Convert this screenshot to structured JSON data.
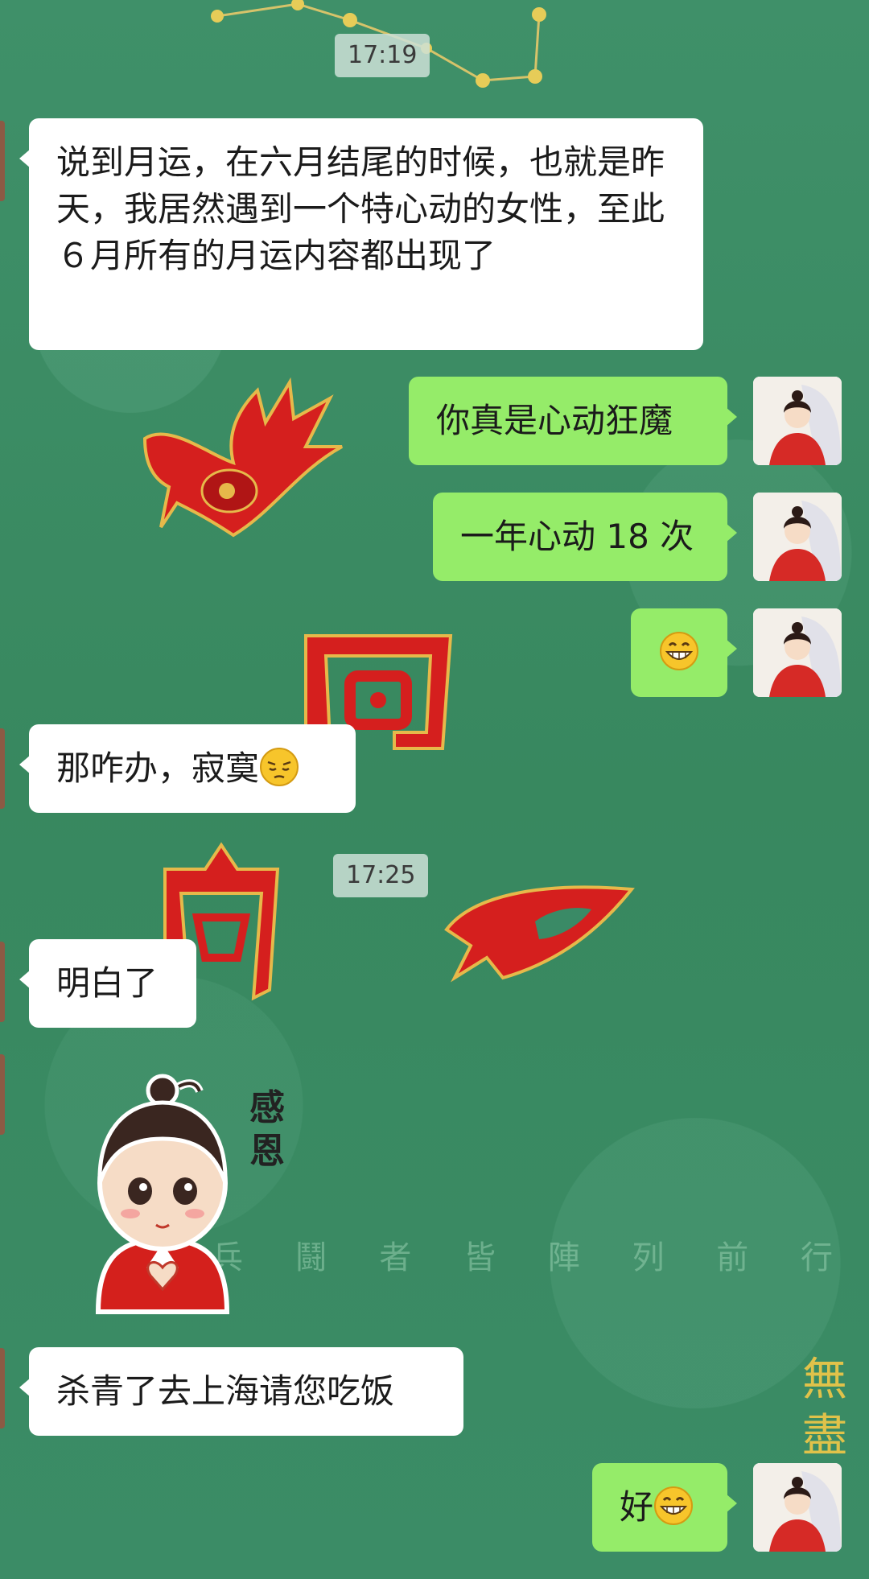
{
  "timestamps": [
    "17:19",
    "17:25"
  ],
  "messages": [
    {
      "side": "in",
      "text": "说到月运，在六月结尾的时候，也就是昨天，我居然遇到一个特心动的女性，至此６月所有的月运内容都出现了"
    },
    {
      "side": "out",
      "text": "你真是心动狂魔"
    },
    {
      "side": "out",
      "text": "一年心动 18 次"
    },
    {
      "side": "out",
      "text": "",
      "emoji": "grin-emoji"
    },
    {
      "side": "in",
      "text": "那咋办，寂寞",
      "emoji": "pensive-emoji"
    },
    {
      "side": "in",
      "text": "明白了"
    },
    {
      "side": "in",
      "sticker": "thanks-sticker",
      "sticker_text": "感恩"
    },
    {
      "side": "in",
      "text": "杀青了去上海请您吃饭"
    },
    {
      "side": "out",
      "text": "好",
      "emoji": "grin-emoji"
    }
  ],
  "wallpaper": {
    "text": "兵 鬪 者 皆 陣 列 前 行",
    "seal_text": "無 盡",
    "colors": {
      "background": "#3a8a66",
      "symbol": "#d41f1f"
    }
  },
  "colors": {
    "incoming_bubble": "#ffffff",
    "outgoing_bubble": "#95ec69"
  }
}
